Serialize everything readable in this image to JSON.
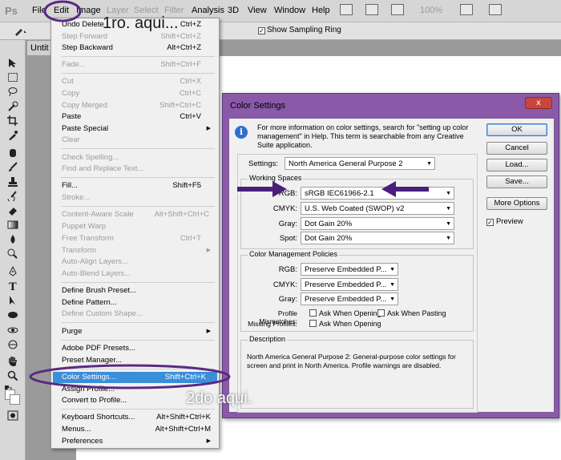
{
  "app": {
    "logo": "Ps"
  },
  "menubar": {
    "items": [
      "File",
      "Edit",
      "Image",
      "Layer",
      "Select",
      "Filter",
      "Analysis",
      "3D",
      "View",
      "Window",
      "Help"
    ],
    "zoom": "100%"
  },
  "optbar": {
    "sampling_label": "Show Sampling Ring"
  },
  "document": {
    "tab_label": "Untit"
  },
  "edit_menu": {
    "items": [
      {
        "label": "Undo Delete",
        "shortcut": "Ctrl+Z"
      },
      {
        "label": "Step Forward",
        "shortcut": "Shift+Ctrl+Z"
      },
      {
        "label": "Step Backward",
        "shortcut": "Alt+Ctrl+Z"
      },
      {
        "label": "Fade...",
        "shortcut": "Shift+Ctrl+F"
      },
      {
        "label": "Cut",
        "shortcut": "Ctrl+X"
      },
      {
        "label": "Copy",
        "shortcut": "Ctrl+C"
      },
      {
        "label": "Copy Merged",
        "shortcut": "Shift+Ctrl+C"
      },
      {
        "label": "Paste",
        "shortcut": "Ctrl+V"
      },
      {
        "label": "Paste Special",
        "shortcut": ""
      },
      {
        "label": "Clear",
        "shortcut": ""
      },
      {
        "label": "Check Spelling...",
        "shortcut": ""
      },
      {
        "label": "Find and Replace Text...",
        "shortcut": ""
      },
      {
        "label": "Fill...",
        "shortcut": "Shift+F5"
      },
      {
        "label": "Stroke...",
        "shortcut": ""
      },
      {
        "label": "Content-Aware Scale",
        "shortcut": "Alt+Shift+Ctrl+C"
      },
      {
        "label": "Puppet Warp",
        "shortcut": ""
      },
      {
        "label": "Free Transform",
        "shortcut": "Ctrl+T"
      },
      {
        "label": "Transform",
        "shortcut": ""
      },
      {
        "label": "Auto-Align Layers...",
        "shortcut": ""
      },
      {
        "label": "Auto-Blend Layers...",
        "shortcut": ""
      },
      {
        "label": "Define Brush Preset...",
        "shortcut": ""
      },
      {
        "label": "Define Pattern...",
        "shortcut": ""
      },
      {
        "label": "Define Custom Shape...",
        "shortcut": ""
      },
      {
        "label": "Purge",
        "shortcut": ""
      },
      {
        "label": "Adobe PDF Presets...",
        "shortcut": ""
      },
      {
        "label": "Preset Manager...",
        "shortcut": ""
      },
      {
        "label": "Color Settings...",
        "shortcut": "Shift+Ctrl+K"
      },
      {
        "label": "Assign Profile...",
        "shortcut": ""
      },
      {
        "label": "Convert to Profile...",
        "shortcut": ""
      },
      {
        "label": "Keyboard Shortcuts...",
        "shortcut": "Alt+Shift+Ctrl+K"
      },
      {
        "label": "Menus...",
        "shortcut": "Alt+Shift+Ctrl+M"
      },
      {
        "label": "Preferences",
        "shortcut": ""
      }
    ]
  },
  "dialog": {
    "title": "Color Settings",
    "close_glyph": "x",
    "info_glyph": "i",
    "info_text": "For more information on color settings, search for \"setting up color management\" in Help. This term is searchable from any Creative Suite application.",
    "settings_label": "Settings:",
    "settings_value": "North America General Purpose 2",
    "working_spaces": {
      "title": "Working Spaces",
      "rgb_label": "RGB:",
      "rgb_value": "sRGB IEC61966-2.1",
      "cmyk_label": "CMYK:",
      "cmyk_value": "U.S. Web Coated (SWOP) v2",
      "gray_label": "Gray:",
      "gray_value": "Dot Gain 20%",
      "spot_label": "Spot:",
      "spot_value": "Dot Gain 20%"
    },
    "policies": {
      "title": "Color Management Policies",
      "rgb_label": "RGB:",
      "rgb_value": "Preserve Embedded P...",
      "cmyk_label": "CMYK:",
      "cmyk_value": "Preserve Embedded P...",
      "gray_label": "Gray:",
      "gray_value": "Preserve Embedded P...",
      "mismatch_label": "Profile Mismatches:",
      "ask_opening": "Ask When Opening",
      "ask_pasting": "Ask When Pasting",
      "missing_label": "Missing Profiles:",
      "ask_opening_2": "Ask When Opening"
    },
    "description": {
      "title": "Description",
      "text": "North America General Purpose 2:  General-purpose color settings for screen and print in North America. Profile warnings are disabled."
    },
    "buttons": {
      "ok": "OK",
      "cancel": "Cancel",
      "load": "Load...",
      "save": "Save...",
      "more": "More Options"
    },
    "preview_label": "Preview",
    "check_glyph": "✓"
  },
  "annotations": {
    "first": "1ro. aqui...",
    "second": "2do aqui."
  },
  "colors": {
    "annotation_purple": "#5a2a82",
    "selection_blue": "#3b8fd9",
    "dialog_frame": "#8a5aa8"
  }
}
